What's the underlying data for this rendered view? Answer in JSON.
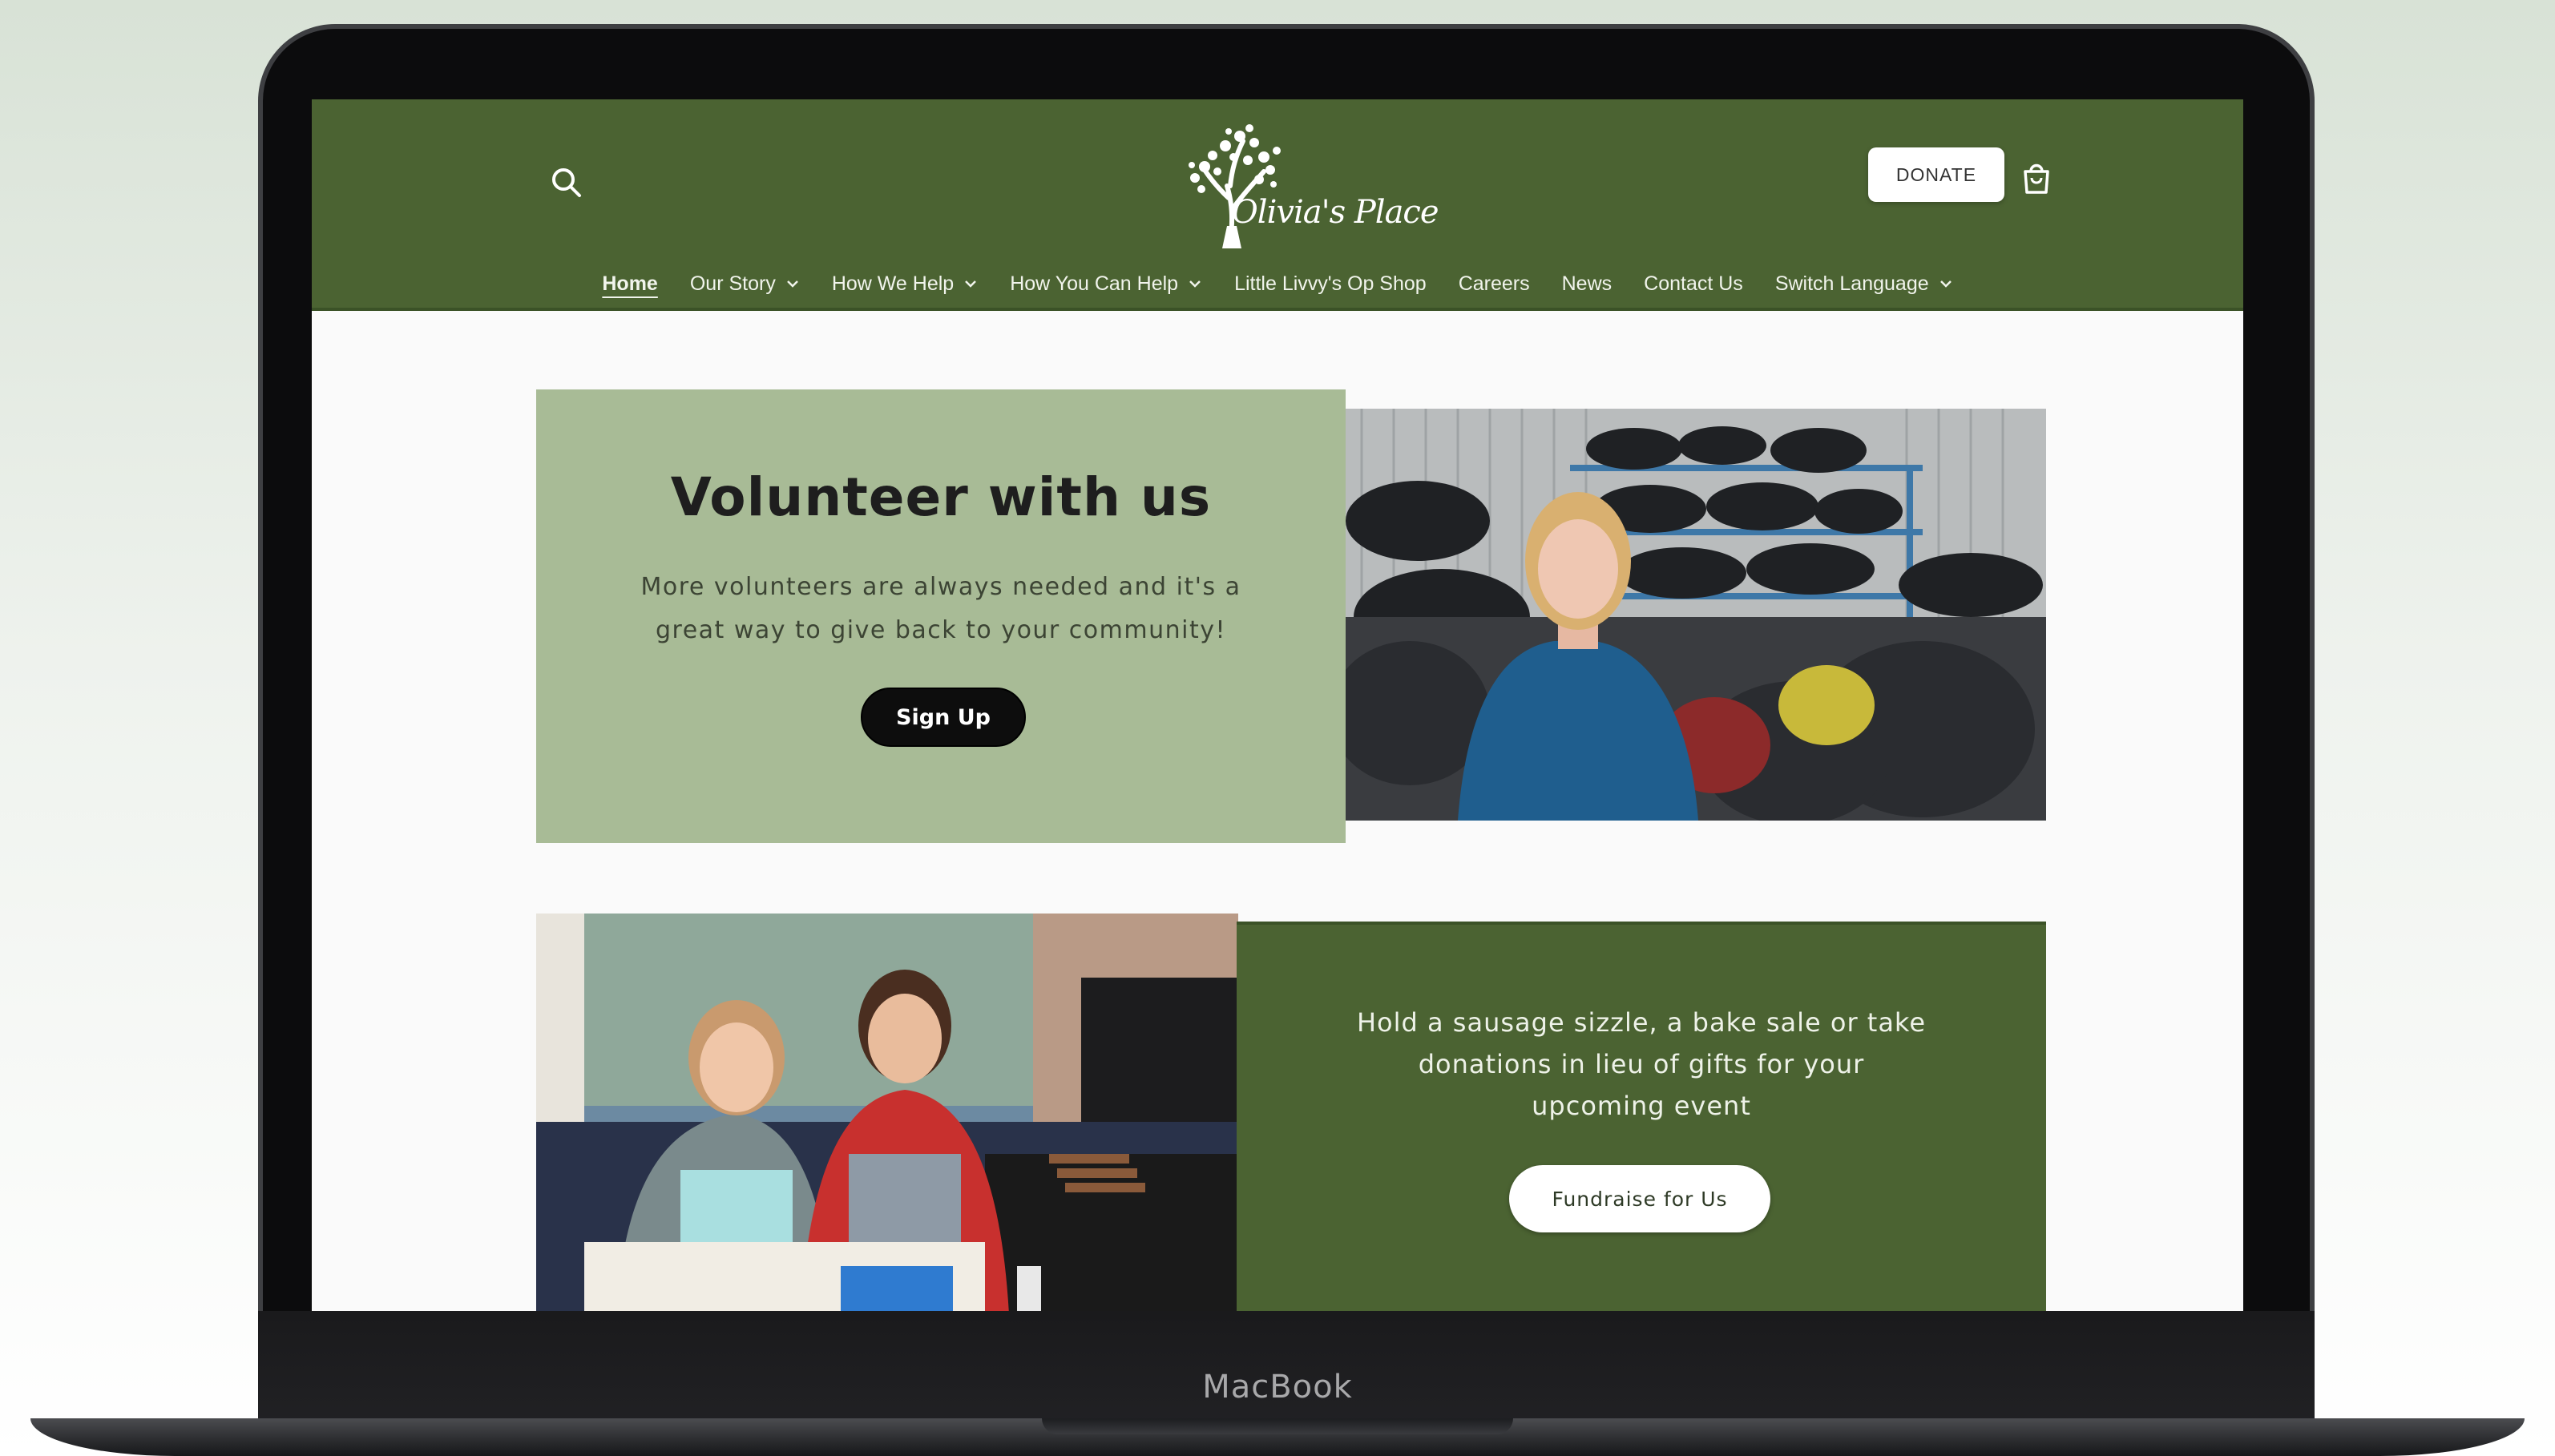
{
  "device": {
    "label": "MacBook"
  },
  "header": {
    "logo_text": "Olivia's Place",
    "donate_label": "DONATE",
    "nav": [
      {
        "label": "Home",
        "active": true,
        "dropdown": false
      },
      {
        "label": "Our Story",
        "dropdown": true
      },
      {
        "label": "How We Help",
        "dropdown": true
      },
      {
        "label": "How You Can Help",
        "dropdown": true
      },
      {
        "label": "Little Livvy's Op Shop",
        "dropdown": false
      },
      {
        "label": "Careers",
        "dropdown": false
      },
      {
        "label": "News",
        "dropdown": false
      },
      {
        "label": "Contact Us",
        "dropdown": false
      },
      {
        "label": "Switch Language",
        "dropdown": true
      }
    ]
  },
  "volunteer": {
    "title": "Volunteer with us",
    "text": "More volunteers are always needed and it's a great way to give back to your community!",
    "button_label": "Sign Up"
  },
  "fundraise": {
    "text": "Hold a sausage sizzle, a bake sale or take donations in lieu of gifts for your upcoming event",
    "button_label": "Fundraise for Us"
  },
  "colors": {
    "header_green": "#4b6332",
    "sage_panel": "#a8bb96",
    "button_dark": "#0d0d0d",
    "page_bg": "#fafafa"
  },
  "icons": [
    "search-icon",
    "tree-logo-icon",
    "cart-icon",
    "chevron-down-icon"
  ]
}
